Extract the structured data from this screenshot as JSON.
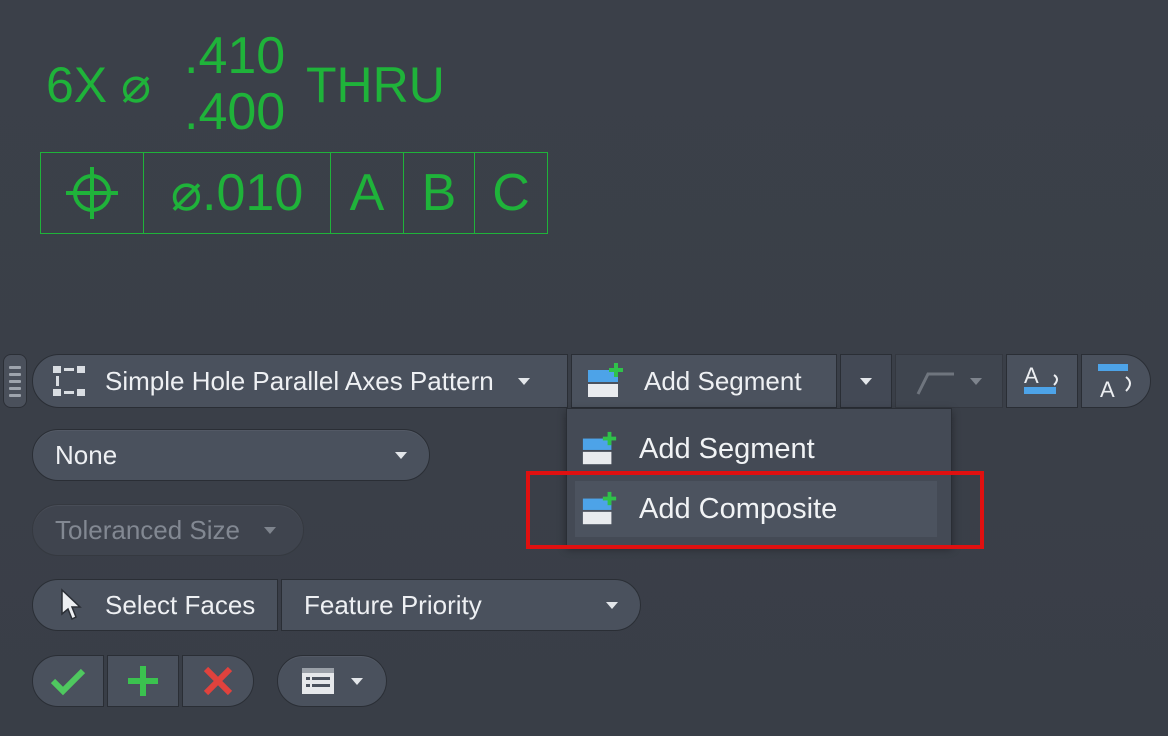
{
  "annotation": {
    "hole_note": {
      "quantity": "6X ⌀",
      "upper_limit": ".410",
      "lower_limit": ".400",
      "depth": "THRU"
    },
    "feature_control_frame": {
      "symbol": "position-icon",
      "tolerance": "⌀.010",
      "datum_a": "A",
      "datum_b": "B",
      "datum_c": "C"
    },
    "color": "#1fb33a"
  },
  "toolbar": {
    "pattern_label": "Simple Hole Parallel Axes Pattern",
    "add_segment_label": "Add Segment"
  },
  "add_menu": {
    "items": [
      {
        "label": "Add Segment",
        "icon": "add-segment-icon"
      },
      {
        "label": "Add Composite",
        "icon": "add-composite-icon"
      }
    ],
    "highlight_color": "#e01010"
  },
  "fields": {
    "modifier_value": "None",
    "tolerance_type": "Toleranced Size",
    "select_faces_label": "Select Faces",
    "priority_value": "Feature Priority"
  },
  "icons": {
    "ok": "checkmark-icon",
    "apply": "plus-icon",
    "cancel": "x-icon",
    "options": "list-options-icon"
  }
}
